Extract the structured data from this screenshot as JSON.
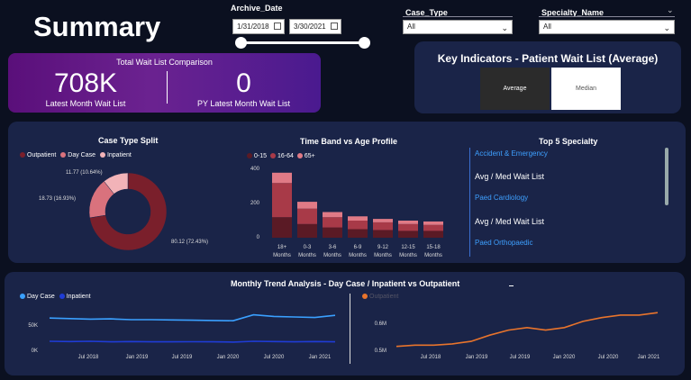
{
  "page_title": "Summary",
  "archive": {
    "label": "Archive_Date",
    "from": "1/31/2018",
    "to": "3/30/2021"
  },
  "filters": {
    "case_type": {
      "label": "Case_Type",
      "value": "All"
    },
    "specialty": {
      "label": "Specialty_Name",
      "value": "All"
    }
  },
  "kpi": {
    "title": "Total Wait List Comparison",
    "left_value": "708K",
    "left_label": "Latest Month Wait List",
    "right_value": "0",
    "right_label": "PY Latest Month Wait List"
  },
  "key_indicators": {
    "title": "Key Indicators - Patient Wait List (Average)",
    "avg_label": "Average",
    "median_label": "Median"
  },
  "case_type_split": {
    "title": "Case Type Split",
    "legend": [
      "Outpatient",
      "Day Case",
      "Inpatient"
    ],
    "labels": [
      "80.12 (72.43%)",
      "18.73 (16.93%)",
      "11.77 (10.64%)"
    ]
  },
  "time_band": {
    "title": "Time Band vs Age Profile",
    "legend": [
      "0-15",
      "16-64",
      "65+"
    ],
    "y_ticks": [
      "400",
      "200",
      "0"
    ],
    "x_line1": [
      "18+",
      "0-3",
      "3-6",
      "6-9",
      "9-12",
      "12-15",
      "15-18"
    ],
    "x_line2": [
      "Months",
      "Months",
      "Months",
      "Months",
      "Months",
      "Months",
      "Months"
    ]
  },
  "top5": {
    "title": "Top 5 Specialty",
    "items": [
      {
        "name": "Accident & Emergency",
        "metric": "Avg / Med Wait List"
      },
      {
        "name": "Paed Cardiology",
        "metric": "Avg / Med Wait List"
      },
      {
        "name": "Paed Orthopaedic"
      }
    ]
  },
  "trend": {
    "title": "Monthly Trend Analysis - Day Case / Inpatient vs Outpatient",
    "left_legend": [
      "Day Case",
      "Inpatient"
    ],
    "left_y": [
      "50K",
      "0K"
    ],
    "left_x": [
      "Jul 2018",
      "Jan 2019",
      "Jul 2019",
      "Jan 2020",
      "Jul 2020",
      "Jan 2021"
    ],
    "right_legend": [
      "Outpatient"
    ],
    "right_y": [
      "0.6M",
      "0.5M"
    ],
    "right_x": [
      "Jul 2018",
      "Jan 2019",
      "Jul 2019",
      "Jan 2020",
      "Jul 2020",
      "Jan 2021"
    ]
  },
  "chart_data": [
    {
      "type": "pie",
      "title": "Case Type Split",
      "categories": [
        "Outpatient",
        "Day Case",
        "Inpatient"
      ],
      "values": [
        80.12,
        18.73,
        11.77
      ],
      "colors": [
        "#7a1f2b",
        "#d9727d",
        "#f2b3b8"
      ]
    },
    {
      "type": "bar",
      "title": "Time Band vs Age Profile",
      "categories": [
        "18+ Months",
        "0-3 Months",
        "3-6 Months",
        "6-9 Months",
        "9-12 Months",
        "12-15 Months",
        "15-18 Months"
      ],
      "series": [
        {
          "name": "0-15",
          "values": [
            120,
            80,
            60,
            50,
            45,
            40,
            40
          ],
          "color": "#5a1a25"
        },
        {
          "name": "16-64",
          "values": [
            200,
            90,
            60,
            50,
            45,
            40,
            35
          ],
          "color": "#a83a48"
        },
        {
          "name": "65+",
          "values": [
            60,
            40,
            30,
            25,
            20,
            20,
            20
          ],
          "color": "#e07a86"
        }
      ],
      "ylim": [
        0,
        400
      ]
    },
    {
      "type": "line",
      "title": "Monthly Trend Analysis - Day Case / Inpatient",
      "x": [
        "Feb 2018",
        "May 2018",
        "Aug 2018",
        "Nov 2018",
        "Feb 2019",
        "May 2019",
        "Aug 2019",
        "Nov 2019",
        "Feb 2020",
        "Apr 2020",
        "Jun 2020",
        "Aug 2020",
        "Nov 2020",
        "Feb 2021",
        "Mar 2021"
      ],
      "series": [
        {
          "name": "Day Case",
          "values": [
            58000,
            57000,
            56000,
            56500,
            55000,
            55000,
            54500,
            54000,
            53500,
            53000,
            64000,
            61000,
            60000,
            59000,
            63000
          ],
          "color": "#3aa0ff"
        },
        {
          "name": "Inpatient",
          "values": [
            15000,
            14500,
            15000,
            14000,
            14500,
            14000,
            14000,
            14200,
            14000,
            13500,
            15000,
            14500,
            14000,
            14500,
            14000
          ],
          "color": "#1f3cd6"
        }
      ],
      "ylim": [
        0,
        75000
      ]
    },
    {
      "type": "line",
      "title": "Outpatient",
      "x": [
        "Feb 2018",
        "May 2018",
        "Aug 2018",
        "Nov 2018",
        "Feb 2019",
        "May 2019",
        "Aug 2019",
        "Nov 2019",
        "Feb 2020",
        "Apr 2020",
        "Jun 2020",
        "Aug 2020",
        "Nov 2020",
        "Feb 2021",
        "Mar 2021"
      ],
      "series": [
        {
          "name": "Outpatient",
          "values": [
            500000,
            505000,
            505000,
            510000,
            520000,
            545000,
            565000,
            575000,
            565000,
            575000,
            600000,
            615000,
            625000,
            625000,
            635000
          ],
          "color": "#e8742c"
        }
      ],
      "ylim": [
        470000,
        650000
      ]
    }
  ]
}
